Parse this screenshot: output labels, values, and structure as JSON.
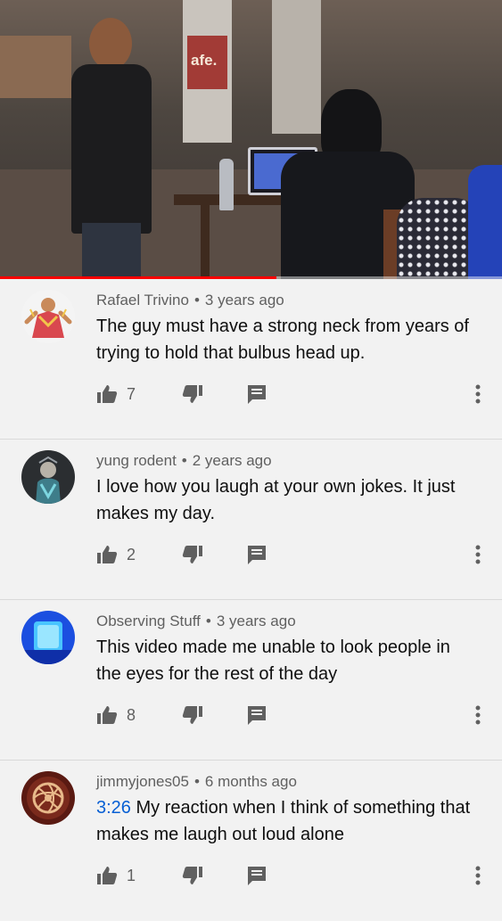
{
  "video": {
    "watermark": "afe.",
    "progress_fraction": 0.55
  },
  "icons": {
    "like": "thumb-up-icon",
    "dislike": "thumb-down-icon",
    "reply": "reply-comment-icon",
    "more": "more-vert-icon"
  },
  "colors": {
    "background": "#f2f2f2",
    "meta_text": "#606060",
    "timestamp_link": "#065fd4",
    "progress": "#ff0000",
    "icon": "#606060"
  },
  "comments": [
    {
      "author": "Rafael Trivino",
      "age": "3 years ago",
      "timestamp_link": "",
      "text": "The guy must have a strong neck from years of trying to hold that bulbus head up.",
      "likes": "7"
    },
    {
      "author": "yung rodent",
      "age": "2 years ago",
      "timestamp_link": "",
      "text": "I love how you laugh at your own jokes. It just makes my day.",
      "likes": "2"
    },
    {
      "author": "Observing Stuff",
      "age": "3 years ago",
      "timestamp_link": "",
      "text": "This video made me unable to look people in the eyes for the rest of the day",
      "likes": "8"
    },
    {
      "author": "jimmyjones05",
      "age": "6 months ago",
      "timestamp_link": "3:26",
      "text": "My reaction when I think of something that makes me laugh out loud alone",
      "likes": "1"
    }
  ]
}
